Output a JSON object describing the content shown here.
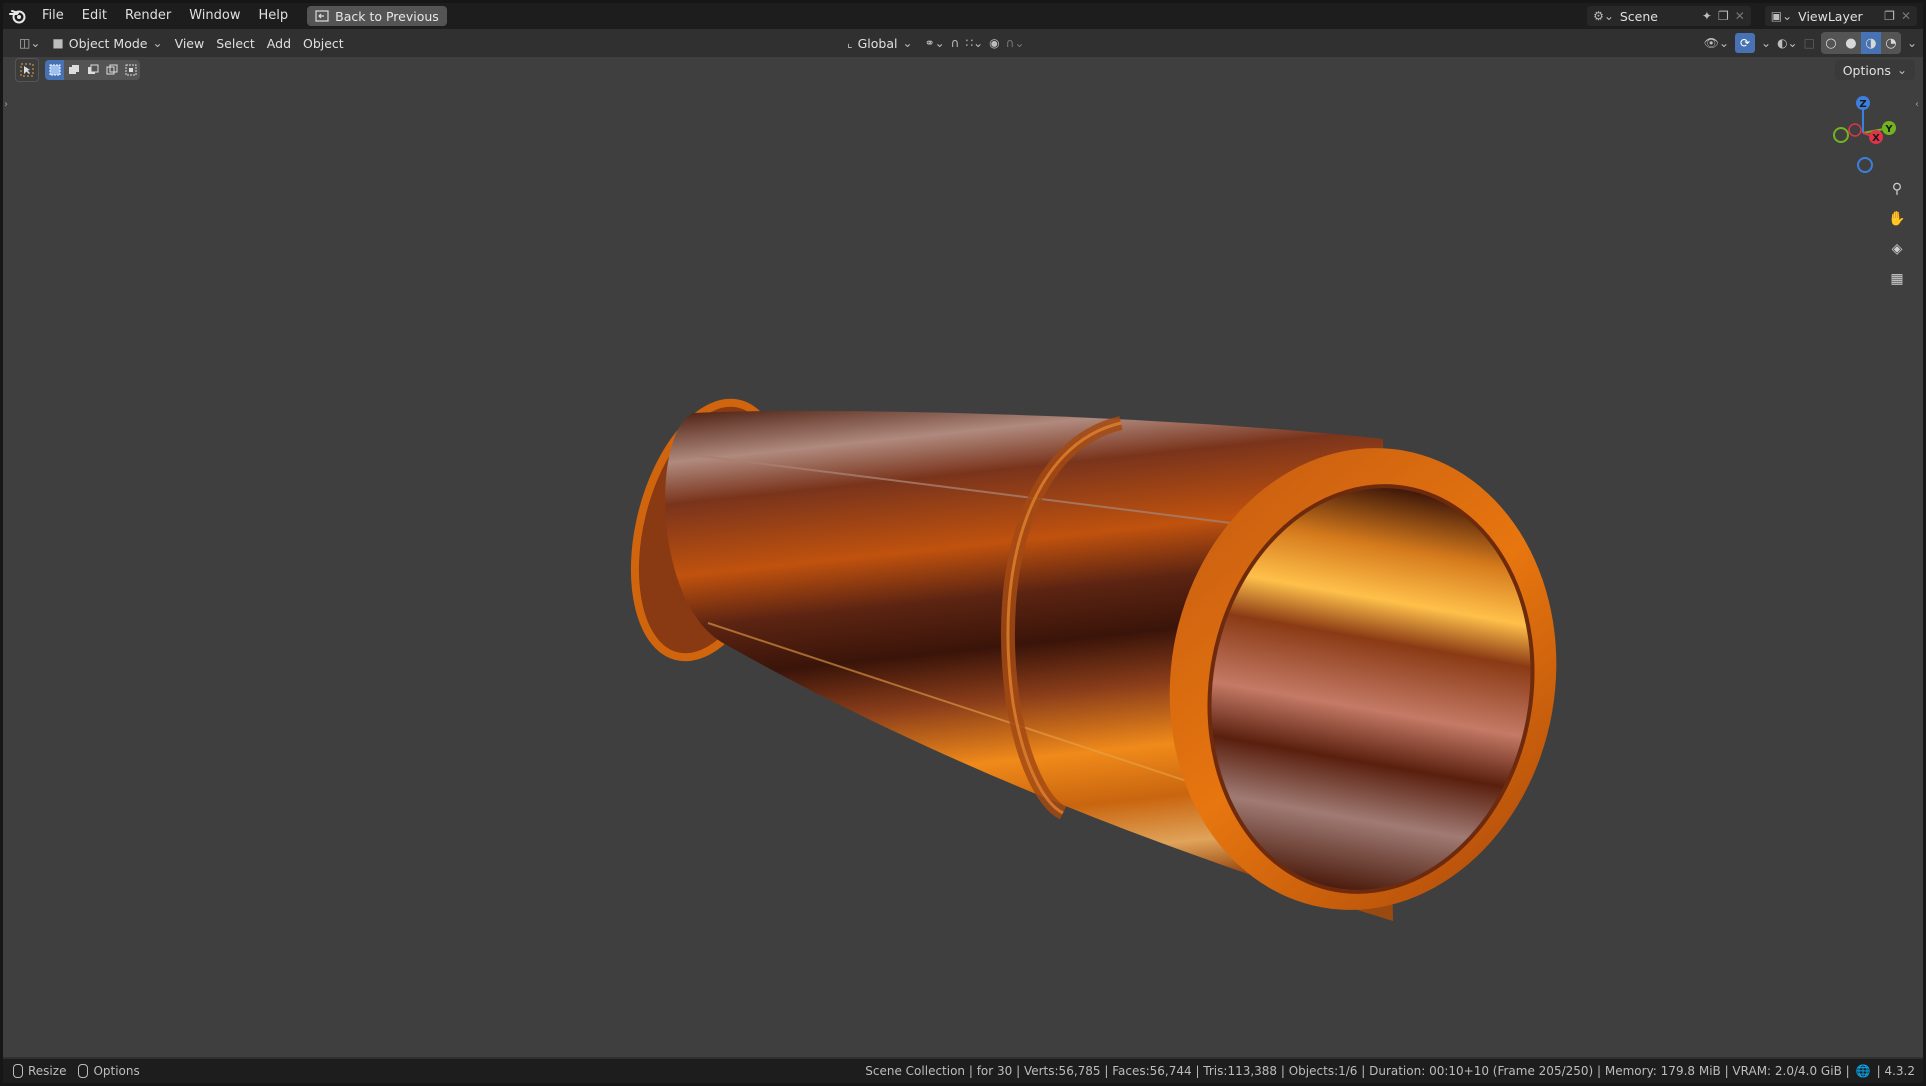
{
  "app": {
    "name": "Blender"
  },
  "menu": {
    "file": "File",
    "edit": "Edit",
    "render": "Render",
    "window": "Window",
    "help": "Help"
  },
  "back_button": {
    "label": "Back to Previous"
  },
  "scene": {
    "value": "Scene"
  },
  "view_layer": {
    "value": "ViewLayer"
  },
  "header": {
    "mode": "Object Mode",
    "view": "View",
    "select": "Select",
    "add": "Add",
    "object": "Object",
    "orientation": "Global"
  },
  "options_button": {
    "label": "Options"
  },
  "gizmo": {
    "z": "Z",
    "y": "Y",
    "x": "X"
  },
  "statusbar": {
    "resize": "Resize",
    "options": "Options",
    "stats": "Scene Collection | for 30 | Verts:56,785 | Faces:56,744 | Tris:113,388 | Objects:1/6 | Duration: 00:10+10 (Frame 205/250) | Memory: 179.8 MiB | VRAM: 2.0/4.0 GiB |",
    "version": "| 4.3.2"
  },
  "colors": {
    "viewport": "#3f3f3f",
    "accent": "#4772b3",
    "copper": "#d8660f",
    "axis_x": "#e0344a",
    "axis_y": "#74b320",
    "axis_z": "#3c7fdc"
  },
  "icons": {
    "logo": "blender-logo-icon",
    "back": "back-to-previous-icon",
    "scene": "scene-icon",
    "viewlayer": "viewlayer-icon",
    "zoom": "zoom-icon",
    "pan": "hand-pan-icon",
    "camera": "camera-view-icon",
    "grid": "ortho-grid-icon"
  }
}
